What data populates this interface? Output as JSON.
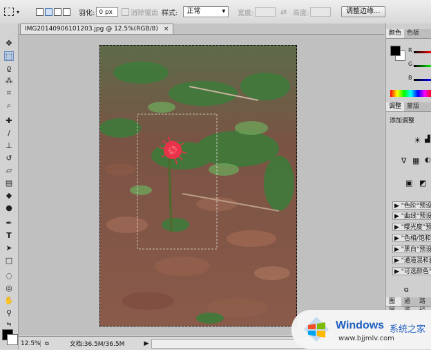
{
  "options_bar": {
    "feather_label": "羽化:",
    "feather_value": "0 px",
    "antialias_label": "消除锯齿",
    "style_label": "样式:",
    "style_value": "正常",
    "width_label": "宽度:",
    "height_label": "高度:",
    "refine_edge_button": "调整边缘..."
  },
  "document": {
    "tab_title": "IMG20140906101203.jpg @ 12.5%(RGB/8)",
    "close_glyph": "×"
  },
  "status": {
    "zoom": "12.5%",
    "doc_info": "文档:36.5M/36.5M"
  },
  "color_panel": {
    "tabs": [
      "颜色",
      "色板"
    ],
    "channels": [
      "R",
      "G",
      "B"
    ]
  },
  "adjust_panel": {
    "tabs": [
      "调整",
      "蒙版"
    ],
    "title": "添加调整",
    "presets": [
      "\"色阶\"预设",
      "\"曲线\"预设",
      "\"曝光度\"预",
      "\"色相/饱和",
      "\"黑白\"预设",
      "\"通道混和器",
      "\"可选颜色\""
    ]
  },
  "layers_panel": {
    "tabs": [
      "图层",
      "通道",
      "路径"
    ]
  },
  "watermark": {
    "brand": "Windows",
    "cn": "系统之家",
    "url": "www.bjjmlv.com"
  },
  "colors": {
    "foreground": "#000000",
    "background": "#ffffff",
    "flower": "#e8334a",
    "brand_blue": "#1f5fbf"
  }
}
